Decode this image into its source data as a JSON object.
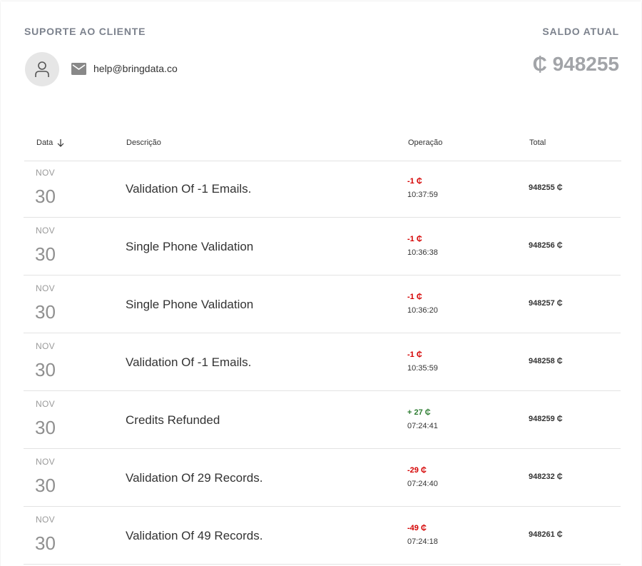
{
  "header": {
    "support_title": "SUPORTE AO CLIENTE",
    "email": "help@bringdata.co",
    "balance_title": "SALDO ATUAL",
    "balance_value": "₵ 948255"
  },
  "table": {
    "columns": {
      "date": "Data",
      "description": "Descrição",
      "operation": "Operação",
      "total": "Total"
    },
    "sort": "descending",
    "rows": [
      {
        "month": "NOV",
        "day": "30",
        "description": "Validation Of -1 Emails.",
        "amount": "-1 ₵",
        "type": "neg",
        "time": "10:37:59",
        "total": "948255 ₵"
      },
      {
        "month": "NOV",
        "day": "30",
        "description": "Single Phone Validation",
        "amount": "-1 ₵",
        "type": "neg",
        "time": "10:36:38",
        "total": "948256 ₵"
      },
      {
        "month": "NOV",
        "day": "30",
        "description": "Single Phone Validation",
        "amount": "-1 ₵",
        "type": "neg",
        "time": "10:36:20",
        "total": "948257 ₵"
      },
      {
        "month": "NOV",
        "day": "30",
        "description": "Validation Of -1 Emails.",
        "amount": "-1 ₵",
        "type": "neg",
        "time": "10:35:59",
        "total": "948258 ₵"
      },
      {
        "month": "NOV",
        "day": "30",
        "description": "Credits Refunded",
        "amount": "+ 27 ₵",
        "type": "pos",
        "time": "07:24:41",
        "total": "948259 ₵"
      },
      {
        "month": "NOV",
        "day": "30",
        "description": "Validation Of 29 Records.",
        "amount": "-29 ₵",
        "type": "neg",
        "time": "07:24:40",
        "total": "948232 ₵"
      },
      {
        "month": "NOV",
        "day": "30",
        "description": "Validation Of 49 Records.",
        "amount": "-49 ₵",
        "type": "neg",
        "time": "07:24:18",
        "total": "948261 ₵"
      }
    ]
  },
  "colors": {
    "negative": "#d50000",
    "positive": "#2e7d32",
    "muted": "#7c828d"
  },
  "icons": {
    "avatar": "user-icon",
    "email": "mail-icon",
    "sort": "arrow-down-icon"
  }
}
